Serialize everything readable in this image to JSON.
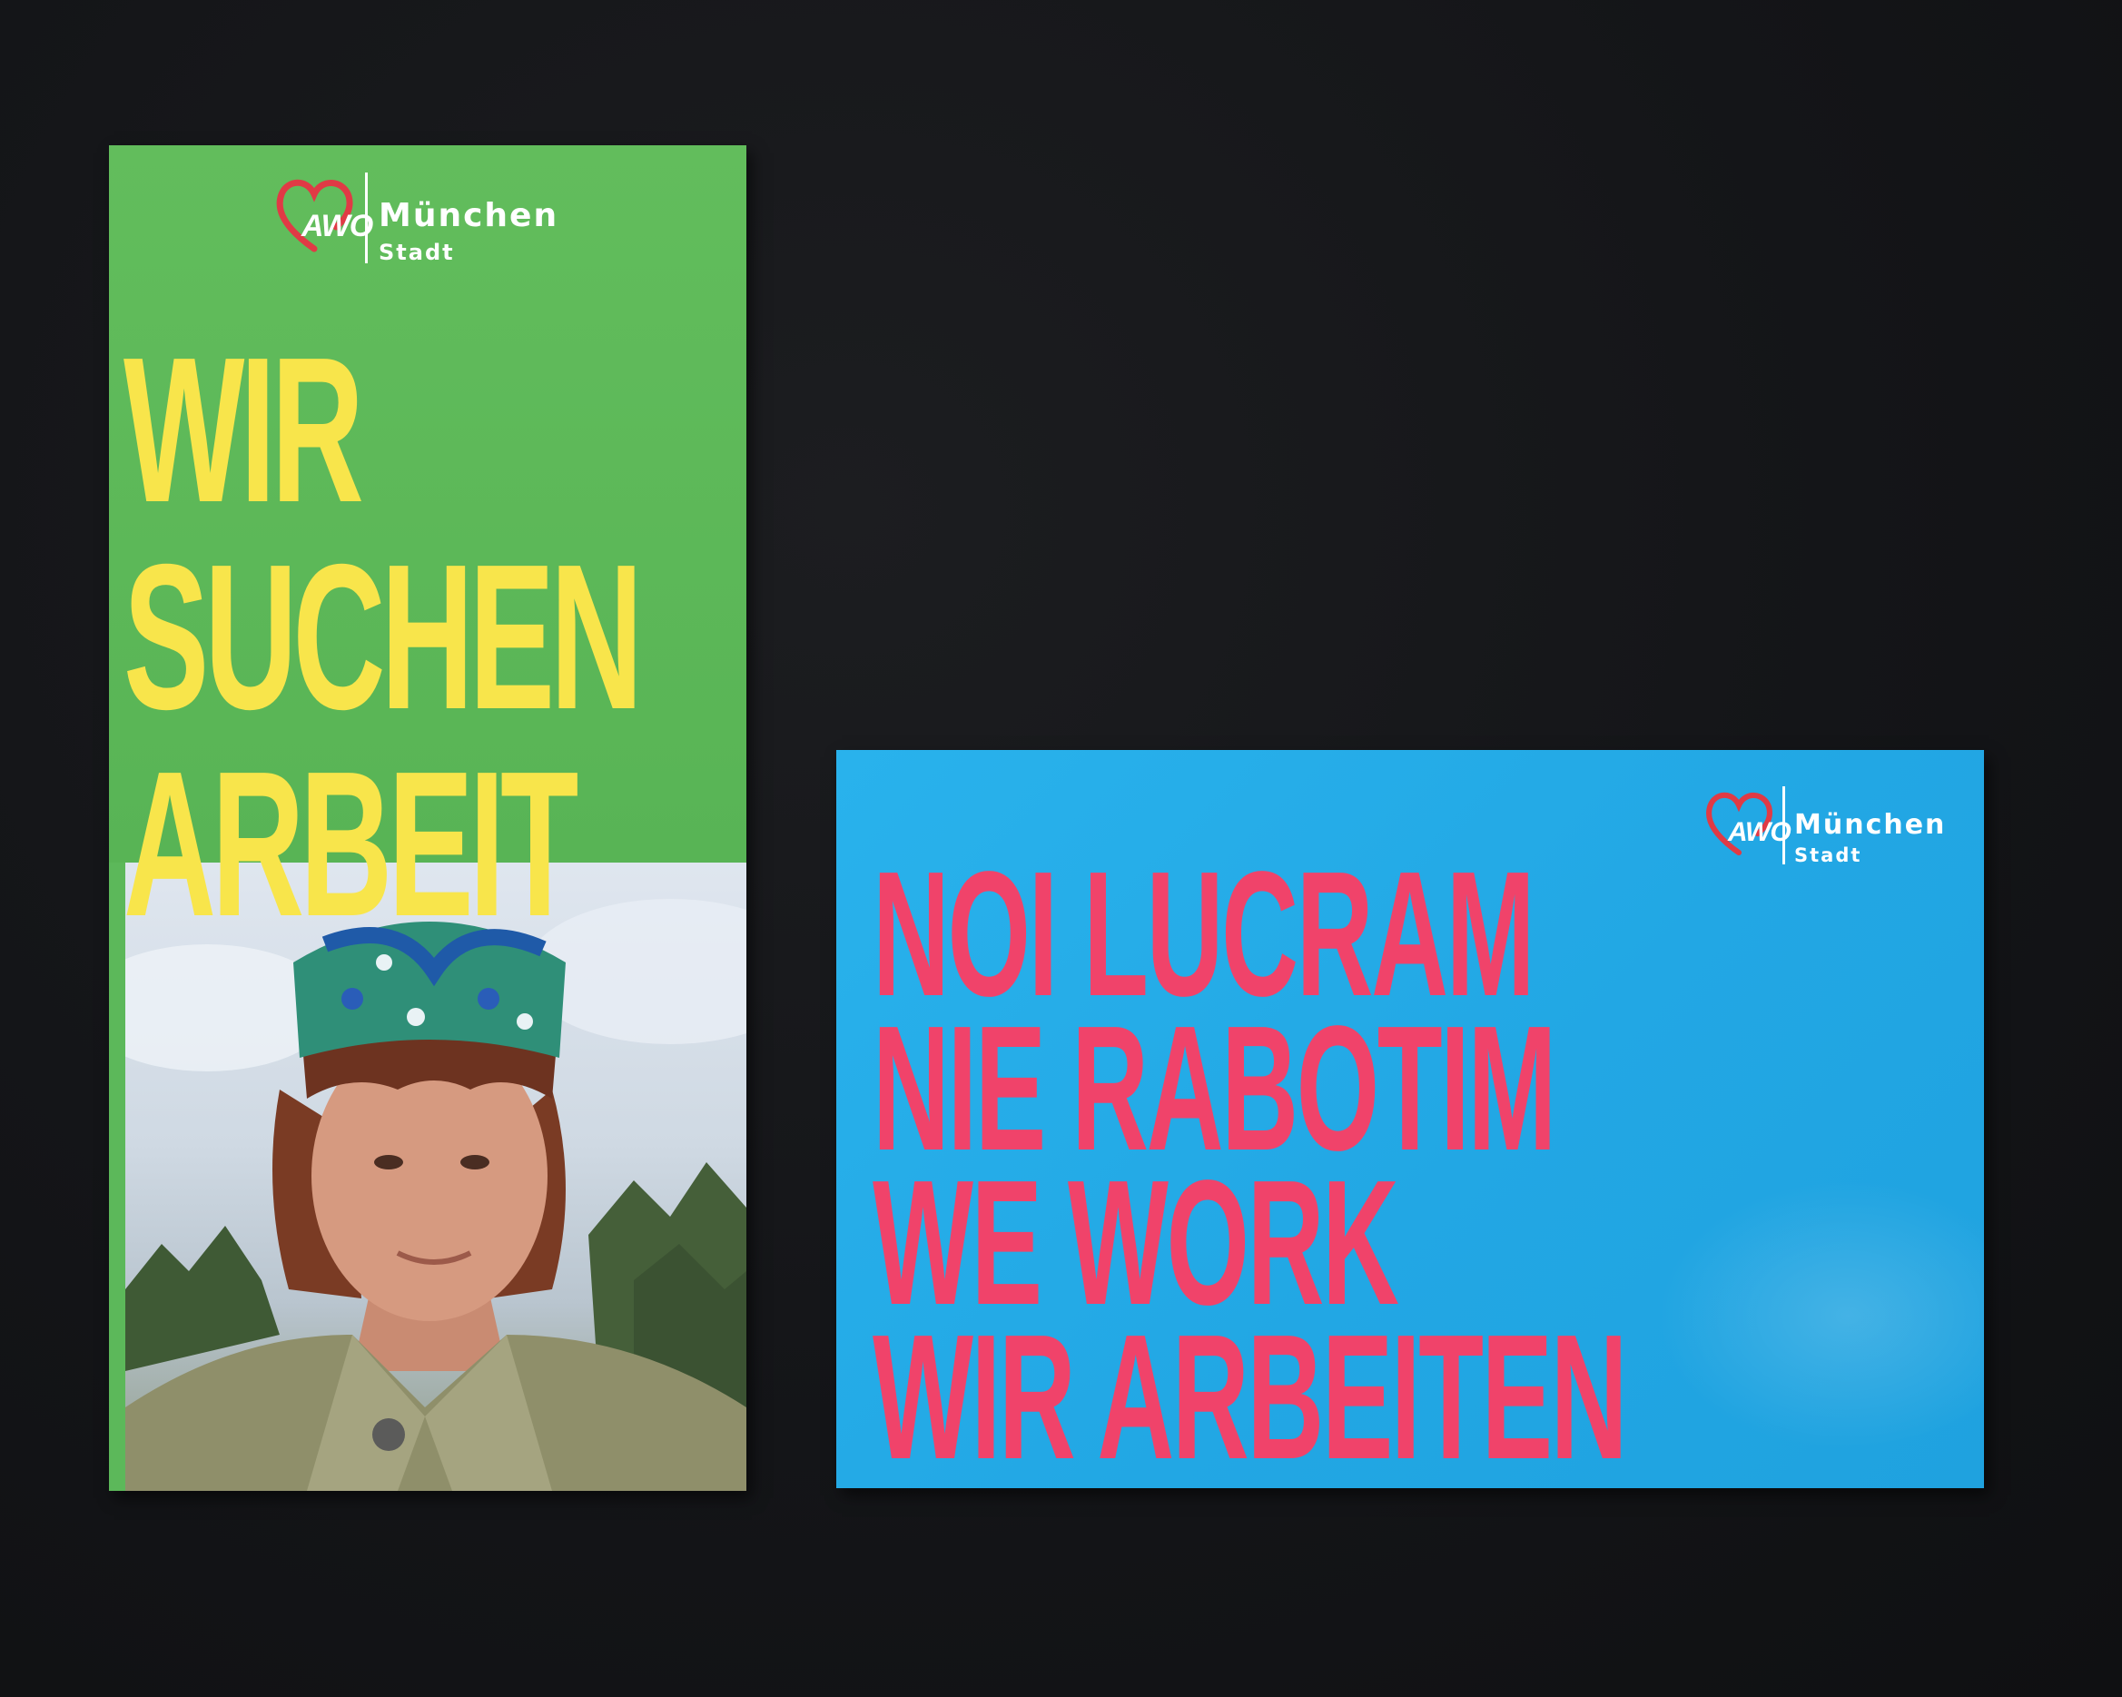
{
  "flyer": {
    "logo": {
      "brand": "AWO",
      "city": "München",
      "sub": "Stadt"
    },
    "headline": [
      "WIR",
      "SUCHEN",
      "ARBEIT"
    ],
    "colors": {
      "background_top": "#5cb85a",
      "headline": "#f8e54b"
    }
  },
  "postcard": {
    "logo": {
      "brand": "AWO",
      "city": "München",
      "sub": "Stadt"
    },
    "headline": [
      "NOI LUCRAM",
      "NIE RABOTIM",
      "WE WORK",
      "WIR ARBEITEN"
    ],
    "colors": {
      "background": "#24aae6",
      "headline": "#f0436a"
    }
  }
}
